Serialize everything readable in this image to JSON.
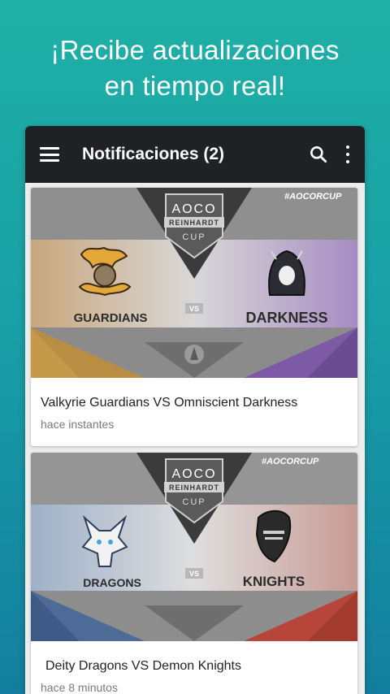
{
  "headline": {
    "line1": "¡Recibe actualizaciones",
    "line2": "en tiempo real!"
  },
  "appbar": {
    "title": "Notificaciones (2)",
    "icons": [
      "menu-icon",
      "search-icon",
      "more-vert-icon"
    ]
  },
  "banner_common": {
    "hashtag": "#AOCORCUP",
    "logo_top": "AOCO",
    "logo_middle": "REINHARDT",
    "logo_bottom": "CUP",
    "vs": "VS"
  },
  "notifications": [
    {
      "left_team": "GUARDIANS",
      "right_team": "DARKNESS",
      "title": "Valkyrie Guardians VS Omniscient Darkness",
      "time": "hace instantes",
      "left_color": "#e0a53a",
      "right_color": "#8a5db5"
    },
    {
      "left_team": "DRAGONS",
      "right_team": "KNIGHTS",
      "title": "Deity Dragons VS Demon Knights",
      "time": "hace 8 minutos",
      "left_color": "#4d6b96",
      "right_color": "#b8453a"
    }
  ],
  "colors": {
    "background_top": "#1fb0a6",
    "background_bottom": "#137e9f",
    "appbar": "#202124"
  }
}
